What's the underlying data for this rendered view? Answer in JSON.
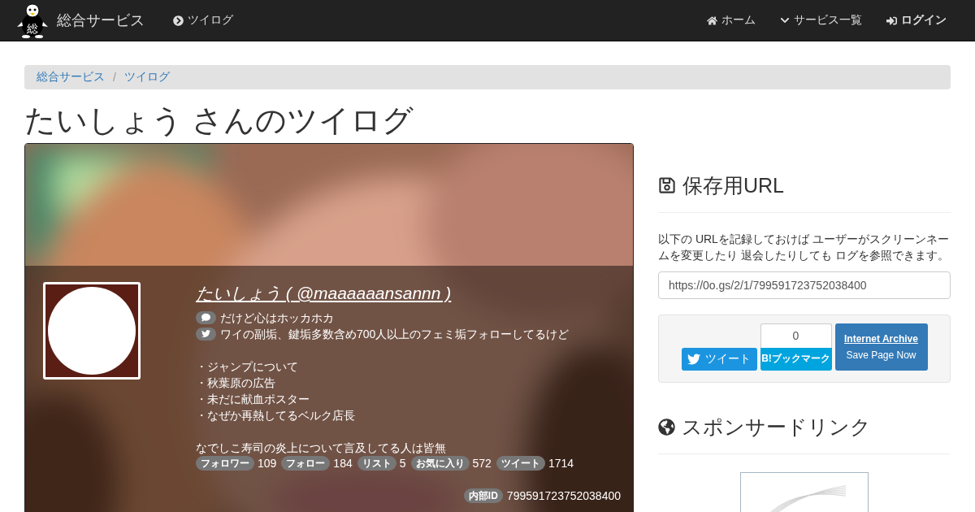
{
  "navbar": {
    "logo_mark": "総",
    "brand": "総合サービス",
    "section": "ツイログ",
    "links": [
      {
        "kind": "home",
        "label": "ホーム",
        "bold": false
      },
      {
        "kind": "menu",
        "label": "サービス一覧",
        "bold": false
      },
      {
        "kind": "login",
        "label": "ログイン",
        "bold": true
      }
    ]
  },
  "breadcrumb": [
    "総合サービス",
    "ツイログ"
  ],
  "breadcrumb_separator": "/",
  "title": "たいしょう さんのツイログ",
  "profile": {
    "name": "たいしょう ( @maaaaaansannn )",
    "status": "だけど心はホッカホカ",
    "bio": [
      [
        "ワイの副垢、鍵垢多数含め700人以上のフェミ垢フォローしてるけど"
      ],
      [
        "・ジャンプについて",
        "・秋葉原の広告",
        "・未だに献血ポスター",
        "・なぜか再熱してるベルク店長"
      ],
      [
        "なでしこ寿司の炎上について言及してる人は皆無"
      ]
    ],
    "stats": [
      {
        "label": "フォロワー",
        "value": "109"
      },
      {
        "label": "フォロー",
        "value": "184"
      },
      {
        "label": "リスト",
        "value": "5"
      },
      {
        "label": "お気に入り",
        "value": "572"
      },
      {
        "label": "ツイート",
        "value": "1714"
      }
    ],
    "internal_id": {
      "label": "内部ID",
      "value": "799591723752038400"
    }
  },
  "save_url": {
    "heading": "保存用URL",
    "description": "以下の URLを記録しておけば ユーザーがスクリーンネームを変更したり 退会したりしても ログを参照できます。",
    "url": "https://0o.gs/2/1/799591723752038400"
  },
  "share": {
    "tweet": "ツイート",
    "bookmark_count": "0",
    "bookmark": "B!ブックマーク",
    "archive_title": "Internet Archive",
    "archive_action": "Save Page Now"
  },
  "sponsor": {
    "heading": "スポンサードリンク"
  }
}
